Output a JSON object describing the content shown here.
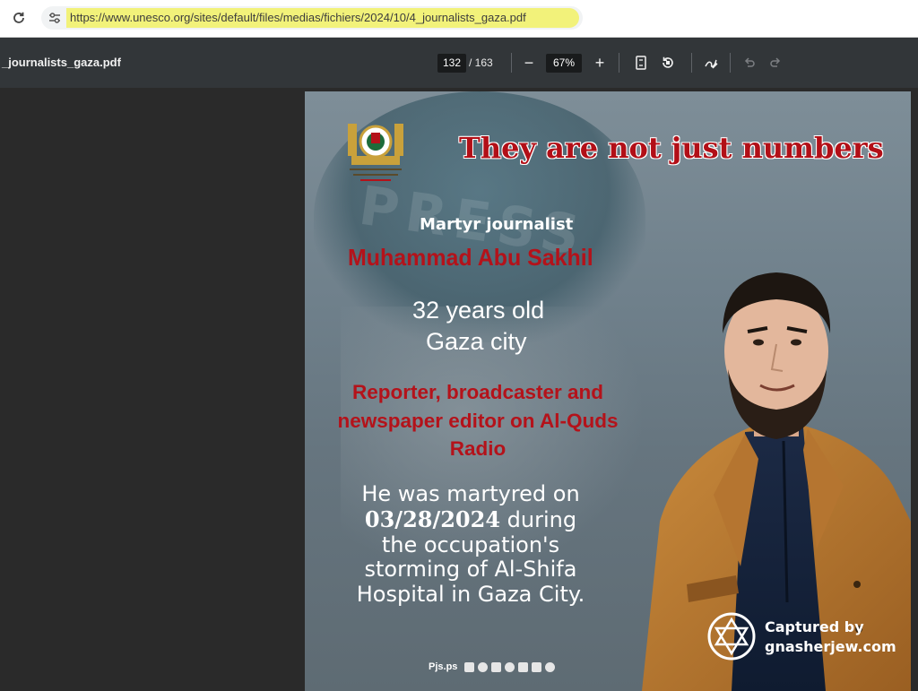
{
  "browser": {
    "url": "https://www.unesco.org/sites/default/files/medias/fichiers/2024/10/4_journalists_gaza.pdf",
    "reload_icon": "reload-icon",
    "site_info_icon": "site-settings-icon",
    "highlight_color": "#f2f27a"
  },
  "toolbar": {
    "doc_title": "_journalists_gaza.pdf",
    "current_page": "132",
    "total_pages": "/ 163",
    "zoom_minus": "−",
    "zoom_level": "67%",
    "zoom_plus": "+"
  },
  "page": {
    "headline": "They are not just numbers",
    "martyr_label": "Martyr journalist",
    "name": "Muhammad  Abu Sakhil",
    "age": "32 years old",
    "city": "Gaza city",
    "role": "Reporter, broadcaster and newspaper editor on Al-Quds Radio",
    "death_line1": "He was martyred on",
    "death_date": "03/28/2024",
    "death_line2": " during",
    "death_line3": "the occupation's",
    "death_line4": "storming of Al-Shifa",
    "death_line5": "Hospital in Gaza City.",
    "social_handle": "Pjs.ps",
    "watermark_line1": "Captured by",
    "watermark_line2": "gnasherjew.com",
    "headline_color": "#b20f17",
    "accent_red": "#b4121a"
  }
}
